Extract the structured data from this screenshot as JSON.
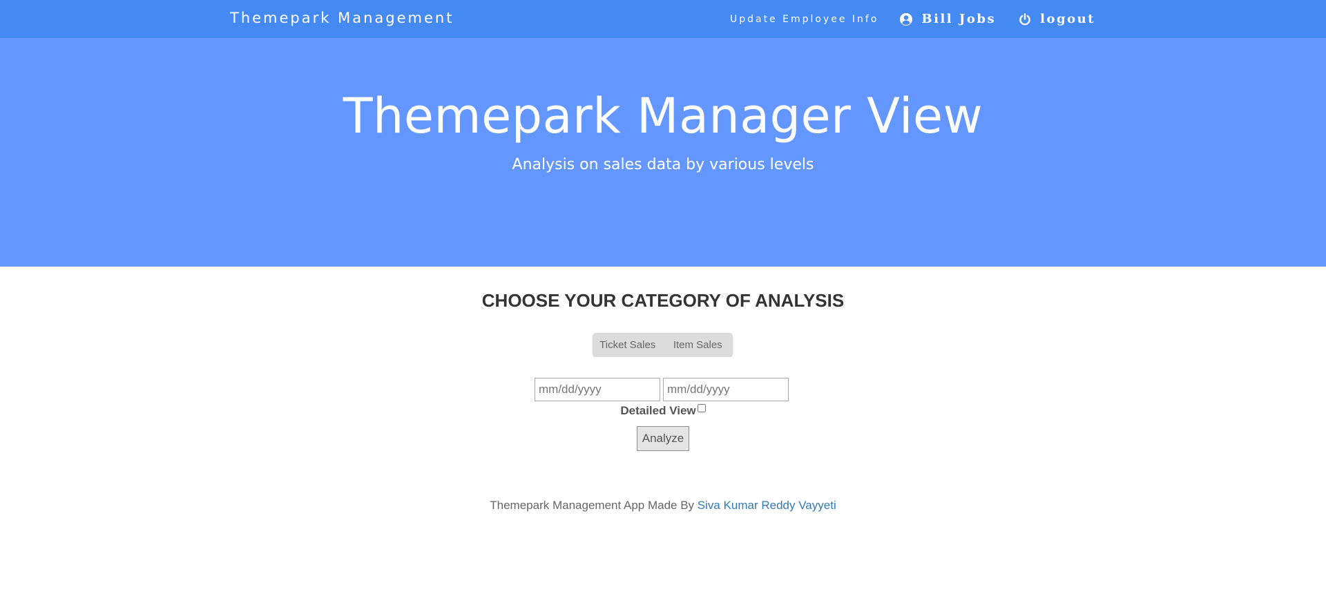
{
  "navbar": {
    "brand": "Themepark Management",
    "update_link": "Update Employee Info",
    "user_name": "Bill Jobs",
    "logout_label": "logout",
    "background_color": "#4589f3",
    "user_icon": "user-circle-icon",
    "logout_icon": "power-icon"
  },
  "hero": {
    "title": "Themepark Manager View",
    "subtitle": "Analysis on sales data by various levels",
    "background_color": "#6397ff"
  },
  "main": {
    "section_title": "CHOOSE YOUR CATEGORY OF ANALYSIS",
    "category_buttons": [
      "Ticket Sales",
      "Item Sales"
    ],
    "start_date_placeholder": "mm/dd/yyyy",
    "end_date_placeholder": "mm/dd/yyyy",
    "detailed_view_label": "Detailed View",
    "detailed_view_checked": false,
    "analyze_label": "Analyze"
  },
  "footer": {
    "text": "Themepark Management App Made By",
    "author": "Siva Kumar Reddy Vayyeti",
    "link_color": "#337ab7"
  }
}
